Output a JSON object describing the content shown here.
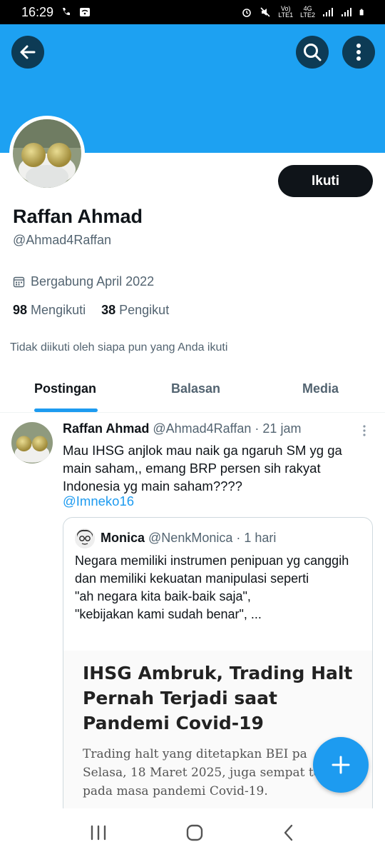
{
  "status_bar": {
    "time": "16:29",
    "net_label_top": "Vo)",
    "net_label_bottom": "LTE1",
    "gen_top": "4G",
    "gen_bottom": "LTE2"
  },
  "header": {
    "back_icon": "arrow-left-icon",
    "search_icon": "search-icon",
    "more_icon": "more-vertical-icon",
    "banner_color": "#1da1f2"
  },
  "profile": {
    "follow_label": "Ikuti",
    "name": "Raffan Ahmad",
    "handle": "@Ahmad4Raffan",
    "joined": "Bergabung April 2022",
    "following_count": "98",
    "following_label": "Mengikuti",
    "followers_count": "38",
    "followers_label": "Pengikut",
    "not_followed_text": "Tidak diikuti oleh siapa pun yang Anda ikuti"
  },
  "tabs": [
    {
      "label": "Postingan",
      "active": true
    },
    {
      "label": "Balasan",
      "active": false
    },
    {
      "label": "Media",
      "active": false
    }
  ],
  "post": {
    "author": "Raffan Ahmad",
    "handle": "@Ahmad4Raffan",
    "sep": "·",
    "time": "21 jam",
    "text": "Mau IHSG anjlok mau naik ga ngaruh SM yg ga main saham,, emang BRP persen sih rakyat Indonesia yg main saham????",
    "mention": "@Imneko16",
    "quote": {
      "author": "Monica",
      "handle": "@NenkMonica",
      "sep": "·",
      "time": "1 hari",
      "line1": "Negara memiliki instrumen penipuan yg canggih dan memiliki kekuatan manipulasi seperti",
      "line2": "\"ah negara kita baik-baik saja\",",
      "line3": "\"kebijakan kami sudah benar\", ...",
      "media_headline": "IHSG Ambruk, Trading Halt Pernah Terjadi saat Pandemi Covid-19",
      "media_p1": "Trading halt yang ditetapkan BEI pa",
      "media_p2": "Selasa, 18 Maret 2025, juga sempat te",
      "media_p3": "pada masa pandemi Covid-19."
    }
  },
  "fab_icon": "plus-icon",
  "accent": "#1d9bf0"
}
